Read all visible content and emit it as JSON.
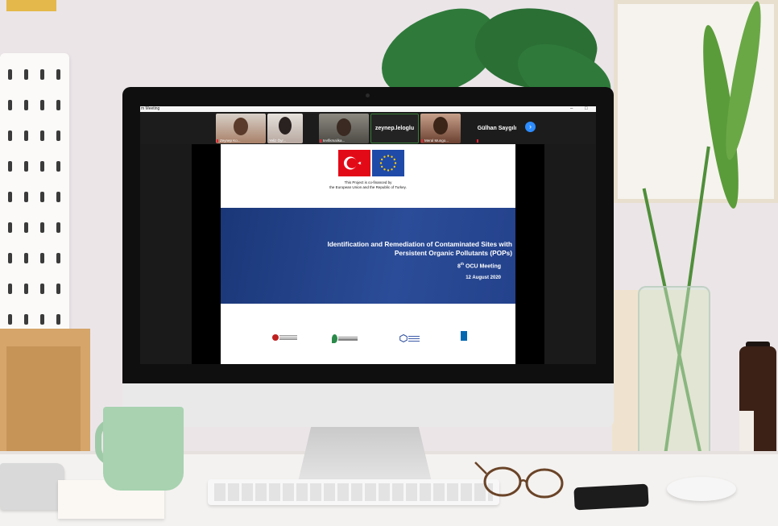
{
  "window": {
    "title": "m Meeting",
    "minimize_label": "–",
    "maximize_label": "□"
  },
  "participants": [
    {
      "name": "Zeynep Ko..."
    },
    {
      "name": "Yeliz Öyr..."
    },
    {
      "name": "tevfikmalika..."
    },
    {
      "name": "zeynep.leloglu"
    },
    {
      "name": "Meral Mungo..."
    },
    {
      "name": "Gülhan Saygılı"
    }
  ],
  "next_button_icon": "chevron-right-icon",
  "slide": {
    "cofinance_line1": "This Project is co-financed by",
    "cofinance_line2": "the European Union and the Republic of Turkey.",
    "title_line1": "Identification and Remediation of Contaminated Sites with",
    "title_line2": "Persistent Organic Pollutants (POPs)",
    "meeting_prefix": "8",
    "meeting_sup": "th",
    "meeting_suffix": " OCU Meeting",
    "date": "12 August 2020"
  },
  "colors": {
    "zoom_blue": "#2d8cff",
    "slide_band": "#2b4c98",
    "turkey_red": "#e30a17",
    "eu_blue": "#1f4aa8"
  }
}
